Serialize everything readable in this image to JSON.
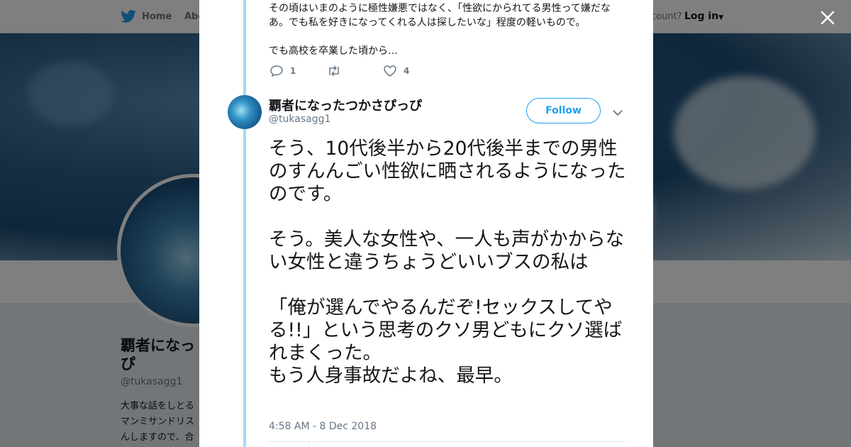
{
  "nav": {
    "home": "Home",
    "about": "Abo",
    "account": "count?",
    "login": "Log in"
  },
  "profile": {
    "name": "覇者になっ\nぴ",
    "handle": "@tukasagg1",
    "bio": "大事な話をしとる\nマンミサンドリス\nんしますので、合\nロック推奨です"
  },
  "prev_tweet": {
    "line1": "その頃はいまのように極性嫌悪ではなく、「性欲にかられてる男性って嫌だな",
    "line2": "あ。でも私を好きになってくれる人は探したいな」程度の軽いもので。",
    "line3": "でも高校を卒業した頃から…",
    "reply_count": "1",
    "retweet_count": "",
    "like_count": "4"
  },
  "tweet": {
    "name": "覇者になったつかさぴっぴ",
    "handle": "@tukasagg1",
    "follow_label": "Follow",
    "para1": "そう、10代後半から20代後半までの男性のすんんごい性欲に晒されるようになったのです。",
    "para2": "そう。美人な女性や、一人も声がかからない女性と違うちょうどいいブスの私は",
    "para3": "「俺が選んでやるんだぞ!セックスしてやる!!」という思考のクソ男どもにクソ選ばれまくった。\nもう人身事故だよね、最早。",
    "timestamp": "4:58 AM - 8 Dec 2018"
  },
  "colors": {
    "accent": "#1da1f2",
    "thread_line": "#aad7f5",
    "muted_text": "#657786"
  },
  "icons": [
    "twitter-bird-icon",
    "close-icon",
    "reply-icon",
    "retweet-icon",
    "like-icon",
    "chevron-down-icon"
  ]
}
